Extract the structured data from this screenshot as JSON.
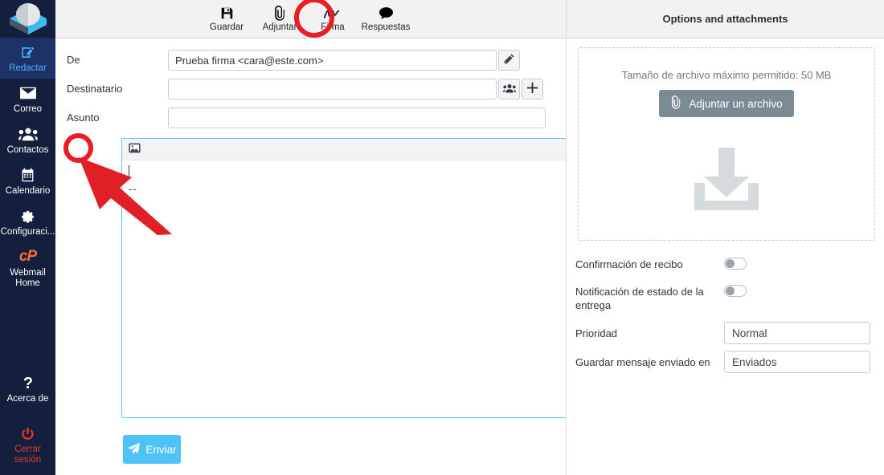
{
  "sidebar": {
    "logo_name": "app-logo",
    "items": [
      {
        "label": "Redactar",
        "icon": "compose-icon",
        "active": true
      },
      {
        "label": "Correo",
        "icon": "envelope-icon",
        "active": false
      },
      {
        "label": "Contactos",
        "icon": "contacts-icon",
        "active": false
      },
      {
        "label": "Calendario",
        "icon": "calendar-icon",
        "active": false
      },
      {
        "label": "Configuraci...",
        "icon": "gear-icon",
        "active": false
      },
      {
        "label_line1": "Webmail",
        "label_line2": "Home",
        "icon": "cpanel-icon",
        "logo_text": "cP",
        "active": false
      }
    ],
    "bottom_items": [
      {
        "label": "Acerca de",
        "icon": "question-icon"
      },
      {
        "label": "Cerrar sesión",
        "icon": "power-icon"
      }
    ],
    "colors": {
      "bg": "#141f3d",
      "active_bg": "#1b3168",
      "active_text": "#45b6f5",
      "logout_text": "#e8392f",
      "cpanel_orange": "#ff6c2c"
    }
  },
  "toolbar": {
    "buttons": [
      {
        "label": "Guardar",
        "icon": "save-icon"
      },
      {
        "label": "Adjuntar",
        "icon": "paperclip-icon"
      },
      {
        "label": "Firma",
        "icon": "signature-icon"
      },
      {
        "label": "Respuestas",
        "icon": "speech-bubble-icon"
      }
    ]
  },
  "panel_header": {
    "title": "Options and attachments"
  },
  "compose": {
    "fields": [
      {
        "label": "De",
        "value": "Prueba firma <cara@este.com>",
        "placeholder": "",
        "action_icon": "pencil-icon"
      },
      {
        "label": "Destinatario",
        "value": "",
        "placeholder": "",
        "action_icon": "contacts-icon",
        "action_icon2": "plus-icon"
      },
      {
        "label": "Asunto",
        "value": "",
        "placeholder": ""
      }
    ],
    "editor": {
      "tool_icon": "insert-image-icon",
      "body_text": "",
      "signature_separator": "--"
    },
    "send_button": {
      "label": "Enviar",
      "icon": "paper-plane-icon",
      "color": "#4ec3f7"
    }
  },
  "attachments": {
    "max_size_text": "Tamaño de archivo máximo permitido: 50 MB",
    "attach_button": {
      "label": "Adjuntar un archivo",
      "icon": "paperclip-icon"
    },
    "dropzone_icon": "download-tray-icon"
  },
  "options": [
    {
      "label": "Confirmación de recibo",
      "type": "toggle",
      "value": "off"
    },
    {
      "label": "Notificación de estado de la entrega",
      "type": "toggle",
      "value": "off"
    },
    {
      "label": "Prioridad",
      "type": "select",
      "value": "Normal"
    },
    {
      "label": "Guardar mensaje enviado en",
      "type": "select",
      "value": "Enviados"
    }
  ],
  "annotations": [
    {
      "name": "firma-highlight-circle",
      "color": "#ec1c24"
    },
    {
      "name": "insert-image-highlight-circle",
      "color": "#ec1c24"
    },
    {
      "name": "pointer-arrow",
      "color": "#e01f26"
    }
  ]
}
